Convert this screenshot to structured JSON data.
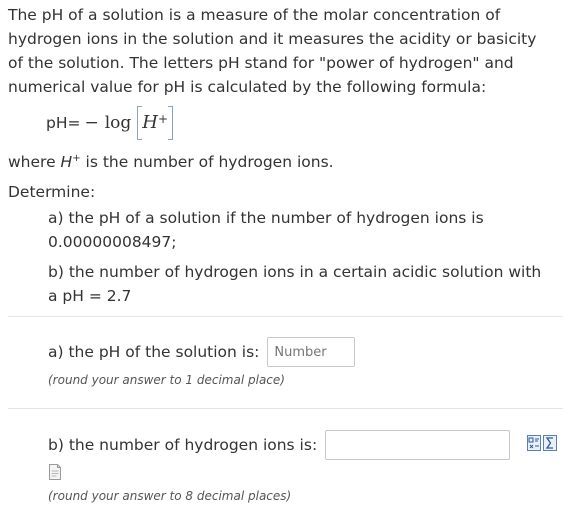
{
  "intro": {
    "line1": "The pH of a solution is a measure of the molar concentration of",
    "line2": "hydrogen ions in the solution and it measures the acidity or basicity",
    "line3": "of the solution. The letters pH stand for \"power of hydrogen\" and",
    "line4": "numerical value for pH is calculated by the following formula:"
  },
  "formula": {
    "lhs": "pH=",
    "minus": "−",
    "log": "log",
    "ion": "H",
    "charge": "+"
  },
  "where": {
    "prefix": "where ",
    "symbol": "H",
    "charge": "+",
    "suffix": " is the number of hydrogen ions."
  },
  "determine": "Determine:",
  "parts": {
    "a_line1": "a) the pH of a solution if the number of hydrogen ions is",
    "a_line2": "0.00000008497;",
    "b_line1": "b) the number of hydrogen ions in a certain acidic solution with",
    "b_line2": "a pH = 2.7"
  },
  "answer_a": {
    "label": "a) the pH of the solution is:",
    "placeholder": "Number",
    "value": "",
    "hint": "(round your answer to 1 decimal place)"
  },
  "answer_b": {
    "label": "b) the number of hydrogen ions is:",
    "placeholder": "",
    "value": "",
    "hint": "(round your answer to 8 decimal places)"
  },
  "icons": {
    "math_editor": "math-editor-icon",
    "formula_editor": "formula-editor-icon",
    "attachment": "document-icon"
  }
}
